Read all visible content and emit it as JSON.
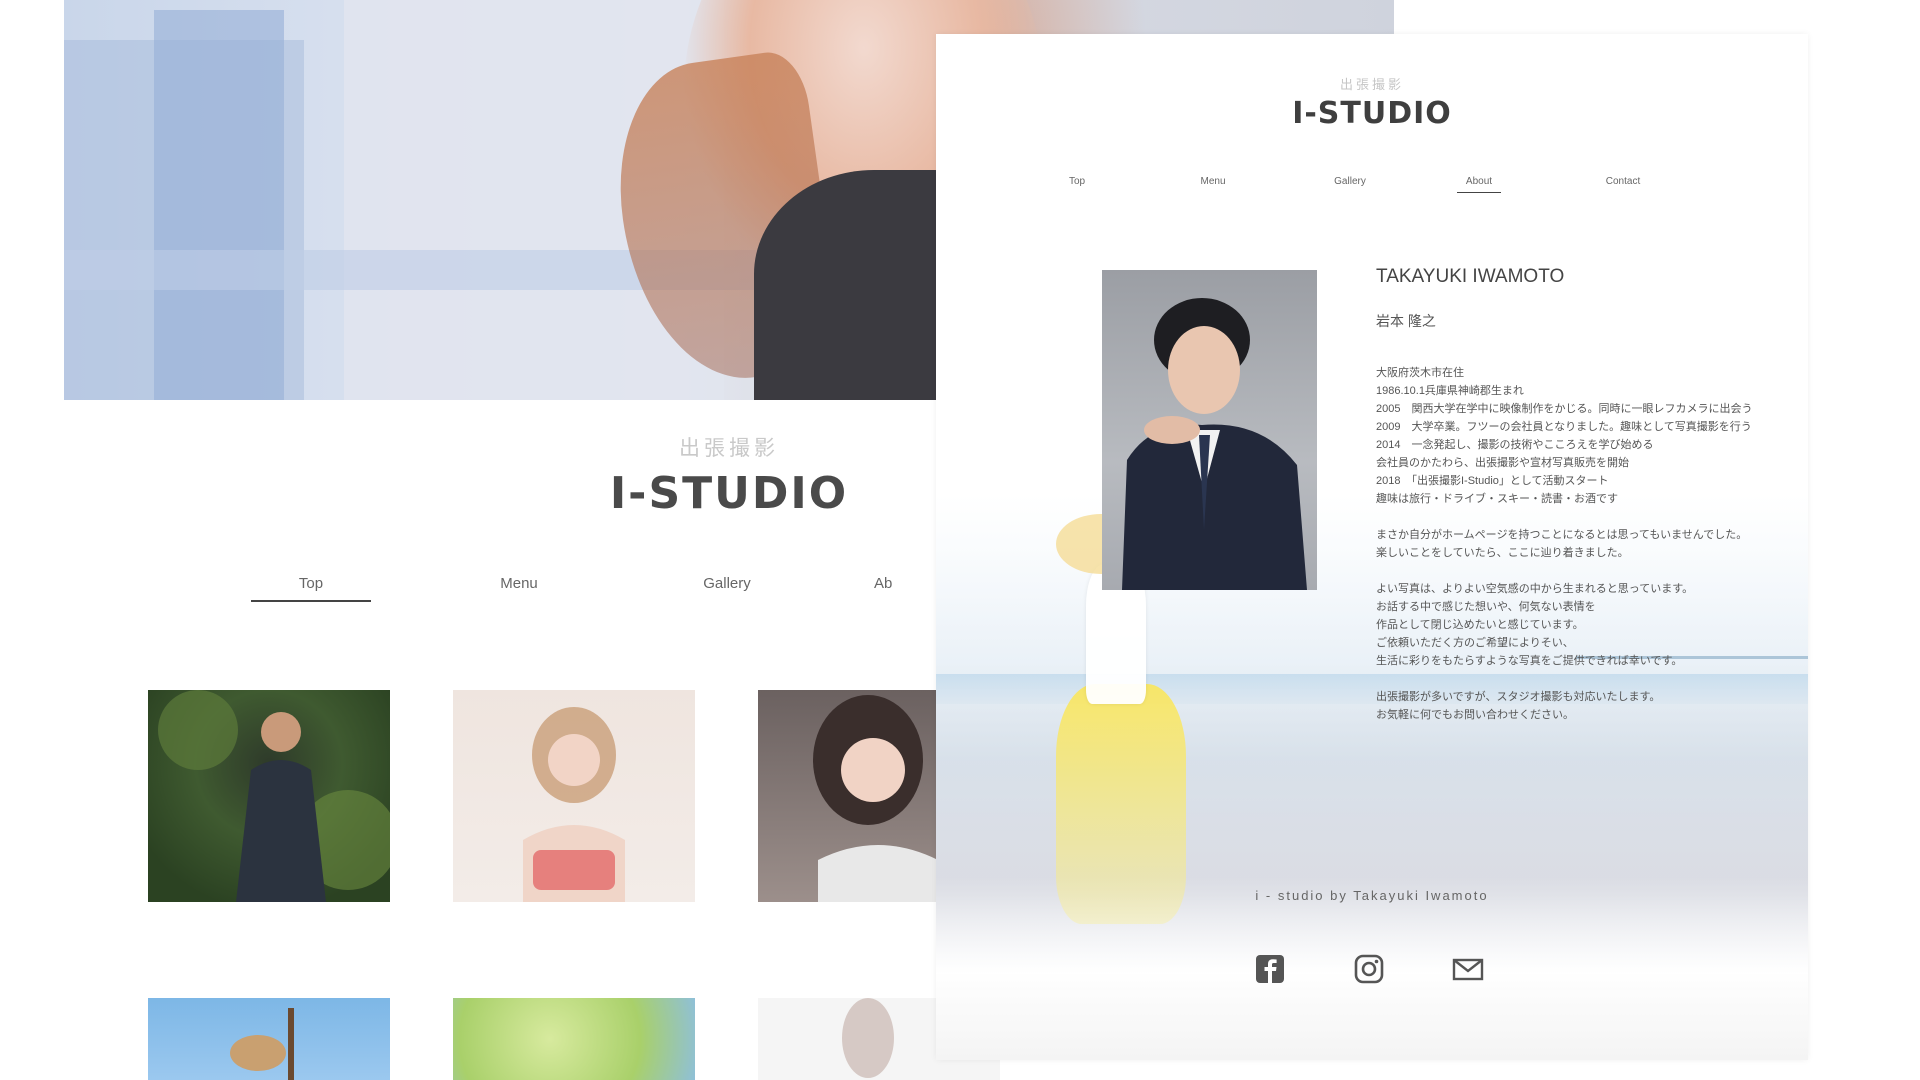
{
  "back_page": {
    "brand_sub": "出張撮影",
    "brand_logo": "I-STUDIO",
    "nav": [
      {
        "label": "Top",
        "active": true
      },
      {
        "label": "Menu",
        "active": false
      },
      {
        "label": "Gallery",
        "active": false
      },
      {
        "label": "Ab",
        "active": false
      }
    ]
  },
  "front_page": {
    "brand_sub": "出張撮影",
    "brand_logo": "I-STUDIO",
    "nav": [
      {
        "label": "Top",
        "active": false
      },
      {
        "label": "Menu",
        "active": false
      },
      {
        "label": "Gallery",
        "active": false
      },
      {
        "label": "About",
        "active": true
      },
      {
        "label": "Contact",
        "active": false
      }
    ],
    "profile": {
      "name_en": "TAKAYUKI IWAMOTO",
      "name_jp": "岩本 隆之",
      "bio_blocks": [
        [
          "大阪府茨木市在住",
          "1986.10.1兵庫県神崎郡生まれ",
          "2005　関西大学在学中に映像制作をかじる。同時に一眼レフカメラに出会う",
          "2009　大学卒業。フツーの会社員となりました。趣味として写真撮影を行う",
          "2014　一念発起し、撮影の技術やこころえを学び始める",
          "会社員のかたわら、出張撮影や宣材写真販売を開始",
          "2018　「出張撮影I-Studio」として活動スタート",
          "趣味は旅行・ドライブ・スキー・読書・お酒です"
        ],
        [
          "まさか自分がホームページを持つことになるとは思ってもいませんでした。",
          "楽しいことをしていたら、ここに辿り着きました。"
        ],
        [
          "よい写真は、よりよい空気感の中から生まれると思っています。",
          "お話する中で感じた想いや、何気ない表情を",
          "作品として閉じ込めたいと感じています。",
          "ご依頼いただく方のご希望によりそい、",
          "生活に彩りをもたらすような写真をご提供できれば幸いです。"
        ],
        [
          "出張撮影が多いですが、スタジオ撮影も対応いたします。",
          "お気軽に何でもお問い合わせください。"
        ]
      ]
    },
    "footer_signature": "i - studio by Takayuki Iwamoto",
    "social_icons": [
      "facebook-icon",
      "instagram-icon",
      "mail-icon"
    ]
  }
}
